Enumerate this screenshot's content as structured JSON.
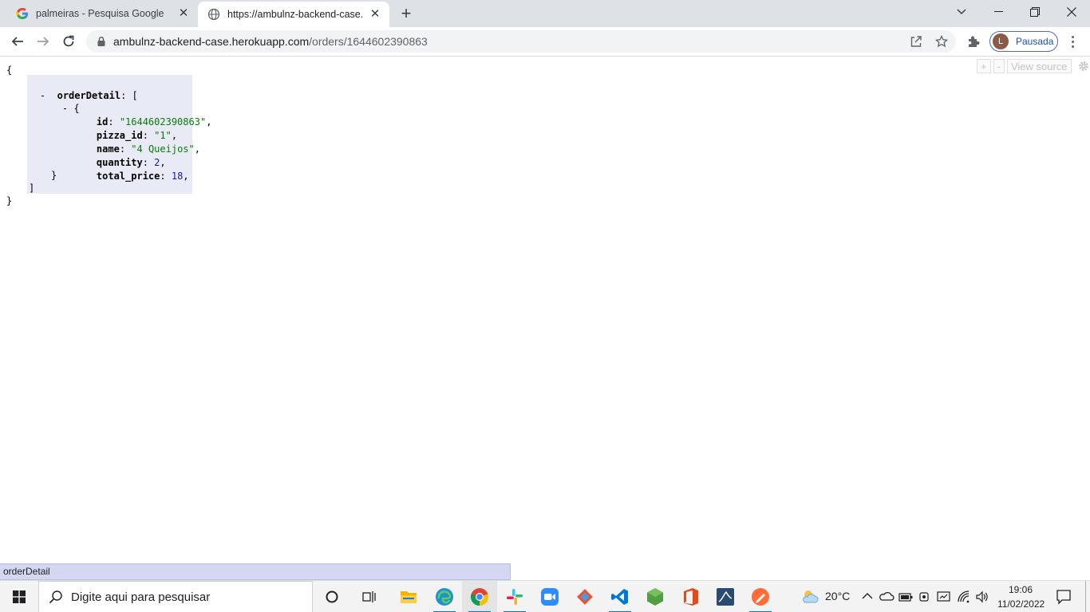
{
  "browser": {
    "tabs": [
      {
        "title": "palmeiras - Pesquisa Google",
        "icon": "google-g-icon",
        "active": false
      },
      {
        "title": "https://ambulnz-backend-case.he",
        "icon": "globe-icon",
        "active": true
      }
    ],
    "new_tab_label": "+",
    "address": {
      "host": "ambulnz-backend-case.herokuapp.com",
      "path": "/orders/1644602390863"
    },
    "profile": {
      "initial": "L",
      "status": "Pausada",
      "avatar_color": "#8a5a44"
    }
  },
  "json_viewer": {
    "toolbar": {
      "expand": "+",
      "collapse": "-",
      "view_source": "View source"
    },
    "lines": {
      "open_brace": "{",
      "order_detail_collapser": "-",
      "order_detail_key": "orderDetail",
      "order_detail_open": ": [",
      "item_collapser": "-",
      "item_open": "{",
      "id_key": "id",
      "id_value": "\"1644602390863\"",
      "pizza_id_key": "pizza_id",
      "pizza_id_value": "\"1\"",
      "name_key": "name",
      "name_value": "\"4 Queijos\"",
      "quantity_key": "quantity",
      "quantity_value": "2",
      "total_price_key": "total_price",
      "total_price_value": "18",
      "item_close": "}",
      "array_close": "]",
      "close_brace": "}"
    },
    "colors": {
      "string": "#0b7a0b",
      "number": "#1a1aa6",
      "highlight": "#e8eaf6"
    }
  },
  "status_bubble": "orderDetail",
  "taskbar": {
    "search_placeholder": "Digite aqui para pesquisar",
    "apps": [
      "cortana-icon",
      "task-view-icon",
      "file-explorer-icon",
      "edge-icon",
      "chrome-icon",
      "slack-icon",
      "zoom-icon",
      "git-icon",
      "vscode-icon",
      "nodejs-icon",
      "office-icon",
      "mysql-workbench-icon",
      "postman-icon"
    ],
    "weather": "20°C",
    "time": "19:06",
    "date": "11/02/2022"
  }
}
